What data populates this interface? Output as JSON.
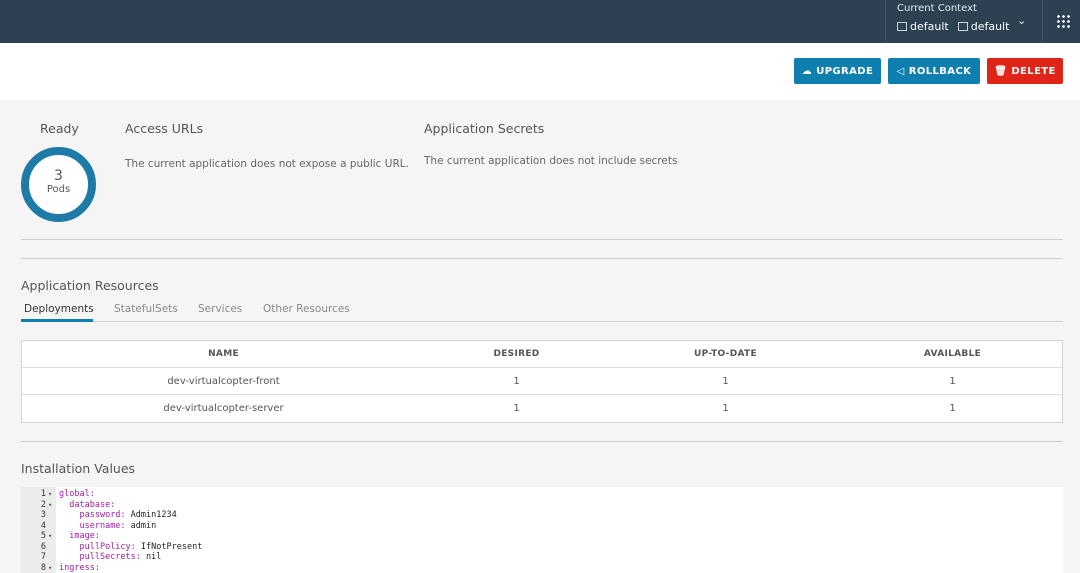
{
  "header": {
    "context_title": "Current Context",
    "cluster": "default",
    "namespace": "default",
    "icons": {
      "cluster": "cluster-icon",
      "namespace": "namespace-icon",
      "chevron": "chevron-down-icon",
      "apps": "app-grid-icon"
    }
  },
  "actions": {
    "upgrade": "UPGRADE",
    "rollback": "ROLLBACK",
    "delete": "DELETE",
    "colors": {
      "primary": "#0f7fb0",
      "danger": "#e02418"
    }
  },
  "summary": {
    "ready_label": "Ready",
    "pods_count": "3",
    "pods_label": "Pods",
    "access_title": "Access URLs",
    "access_text": "The current application does not expose a public URL.",
    "secrets_title": "Application Secrets",
    "secrets_text": "The current application does not include secrets"
  },
  "resources": {
    "title": "Application Resources",
    "tabs": [
      "Deployments",
      "StatefulSets",
      "Services",
      "Other Resources"
    ],
    "active_tab": "Deployments",
    "columns": [
      "NAME",
      "DESIRED",
      "UP-TO-DATE",
      "AVAILABLE"
    ],
    "rows": [
      [
        "dev-virtualcopter-front",
        "1",
        "1",
        "1"
      ],
      [
        "dev-virtualcopter-server",
        "1",
        "1",
        "1"
      ]
    ]
  },
  "installation": {
    "title": "Installation Values",
    "lines": [
      {
        "n": "1",
        "fold": true,
        "indent": "",
        "key": "global:",
        "val": ""
      },
      {
        "n": "2",
        "fold": true,
        "indent": "  ",
        "key": "database:",
        "val": ""
      },
      {
        "n": "3",
        "fold": false,
        "indent": "    ",
        "key": "password:",
        "val": " Admin1234"
      },
      {
        "n": "4",
        "fold": false,
        "indent": "    ",
        "key": "username:",
        "val": " admin"
      },
      {
        "n": "5",
        "fold": true,
        "indent": "  ",
        "key": "image:",
        "val": ""
      },
      {
        "n": "6",
        "fold": false,
        "indent": "    ",
        "key": "pullPolicy:",
        "val": " IfNotPresent"
      },
      {
        "n": "7",
        "fold": false,
        "indent": "    ",
        "key": "pullSecrets:",
        "val": " nil"
      },
      {
        "n": "8",
        "fold": true,
        "indent": "",
        "key": "ingress:",
        "val": ""
      }
    ]
  }
}
